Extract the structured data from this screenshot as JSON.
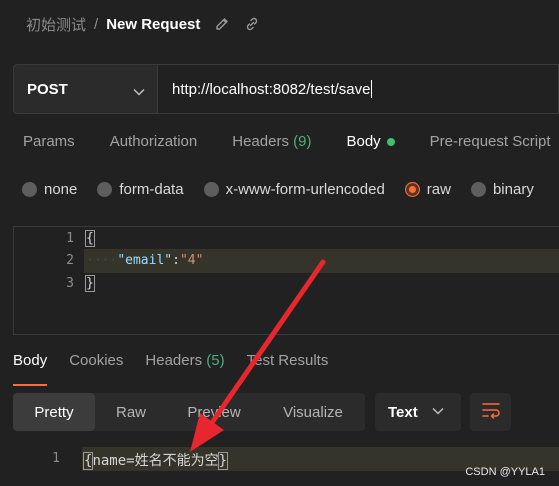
{
  "breadcrumb": {
    "workspace": "初始测试",
    "separator": "/",
    "title": "New Request"
  },
  "request": {
    "method": "POST",
    "url": "http://localhost:8082/test/save"
  },
  "request_tabs": [
    {
      "label": "Params"
    },
    {
      "label": "Authorization"
    },
    {
      "label": "Headers",
      "count": "(9)"
    },
    {
      "label": "Body",
      "active": true
    },
    {
      "label": "Pre-request Script"
    }
  ],
  "body_types": [
    {
      "label": "none"
    },
    {
      "label": "form-data"
    },
    {
      "label": "x-www-form-urlencoded"
    },
    {
      "label": "raw",
      "selected": true
    },
    {
      "label": "binary"
    }
  ],
  "request_body": {
    "line_numbers": [
      "1",
      "2",
      "3"
    ],
    "open_brace": "{",
    "indent": "····",
    "key": "\"email\"",
    "colon": ":",
    "value": "\"4\"",
    "close_brace": "}"
  },
  "response_tabs": [
    {
      "label": "Body",
      "active": true
    },
    {
      "label": "Cookies"
    },
    {
      "label": "Headers",
      "count": "(5)"
    },
    {
      "label": "Test Results"
    }
  ],
  "view_modes": [
    {
      "label": "Pretty",
      "active": true
    },
    {
      "label": "Raw"
    },
    {
      "label": "Preview"
    },
    {
      "label": "Visualize"
    }
  ],
  "format": {
    "selected": "Text"
  },
  "response_body": {
    "line_number": "1",
    "open_brace": "{",
    "content": "name=姓名不能为空",
    "close_brace": "}"
  },
  "watermark": "CSDN @YYLA1",
  "colors": {
    "accent": "#ff6c37",
    "status_green": "#3fbf6f",
    "arrow": "#e8262e",
    "background": "#212121"
  },
  "icons": [
    "edit-icon",
    "link-icon",
    "chevron-down-icon",
    "wrap-lines-icon"
  ]
}
